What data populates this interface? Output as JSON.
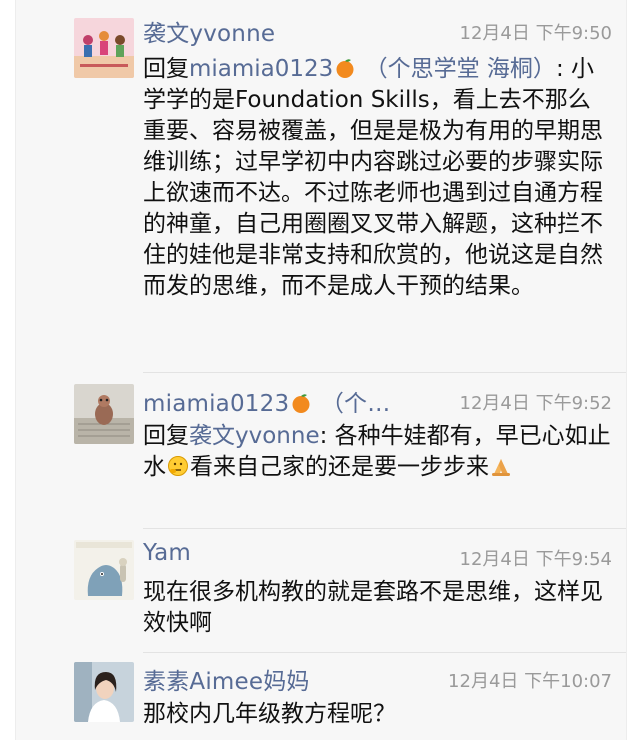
{
  "comments": [
    {
      "author": "袭文yvonne",
      "time": "12月4日 下午9:50",
      "reply_prefix": "回复",
      "reply_to": "miamia0123",
      "reply_to_suffix": " （个思学堂 海桐）",
      "text": ": 小学学的是Foundation Skills，看上去不那么重要、容易被覆盖，但是是极为有用的早期思维训练；过早学初中内容跳过必要的步骤实际上欲速而不达。不过陈老师也遇到过自通方程的神童，自己用圈圈叉叉带入解题，这种拦不住的娃他是非常支持和欣赏的，他说这是自然而发的思维，而不是成人干预的结果。",
      "icons": {
        "avatar": "children-illustration-avatar",
        "emoji": "orange-emoji"
      }
    },
    {
      "author": "miamia0123",
      "author_suffix": " （个…",
      "time": "12月4日 下午9:52",
      "reply_prefix": "回复",
      "reply_to": "袭文yvonne",
      "text_before_emoji": ": 各种牛娃都有，早已心如止水",
      "text_after_emoji": "看来自己家的还是要一步步来",
      "icons": {
        "avatar": "figurine-photo-avatar",
        "emoji_author": "orange-emoji",
        "emoji_1": "thinking-face-emoji",
        "emoji_2": "praying-hands-emoji"
      }
    },
    {
      "author": "Yam",
      "time": "12月4日 下午9:54",
      "text": "现在很多机构教的就是套路不是思维，这样见效快啊",
      "icons": {
        "avatar": "cartoon-dino-avatar"
      }
    },
    {
      "author": "素素Aimee妈妈",
      "time": "12月4日 下午10:07",
      "text": "那校内几年级教方程呢？",
      "icons": {
        "avatar": "woman-photo-avatar"
      }
    }
  ],
  "colors": {
    "name_link": "#576b95",
    "time": "#9a9a9a",
    "panel_bg": "#f7f7f7"
  }
}
